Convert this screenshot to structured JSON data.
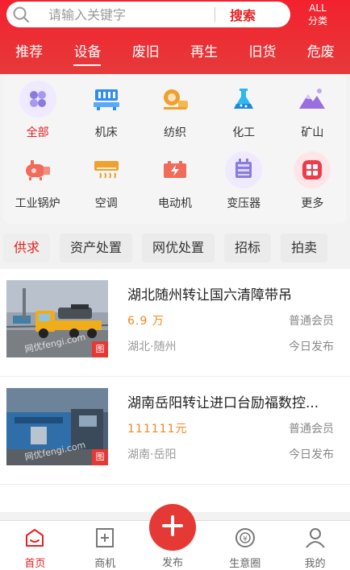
{
  "search": {
    "placeholder": "请输入关键字",
    "button_label": "搜索"
  },
  "all_categories": {
    "line1": "ALL",
    "line2": "分类"
  },
  "tabs": [
    {
      "label": "推荐"
    },
    {
      "label": "设备"
    },
    {
      "label": "废旧"
    },
    {
      "label": "再生"
    },
    {
      "label": "旧货"
    },
    {
      "label": "危废"
    }
  ],
  "active_tab": "设备",
  "categories": [
    {
      "label": "全部",
      "icon": "flower-icon",
      "color": "#8a7be0"
    },
    {
      "label": "机床",
      "icon": "machine-tool-icon",
      "color": "#2d8cf0"
    },
    {
      "label": "纺织",
      "icon": "textile-icon",
      "color": "#f0a02d"
    },
    {
      "label": "化工",
      "icon": "flask-icon",
      "color": "#2db7f5"
    },
    {
      "label": "矿山",
      "icon": "mountain-icon",
      "color": "#9b6de0"
    },
    {
      "label": "工业锅炉",
      "icon": "boiler-icon",
      "color": "#f06b5a"
    },
    {
      "label": "空调",
      "icon": "air-conditioner-icon",
      "color": "#f0a02d"
    },
    {
      "label": "电动机",
      "icon": "battery-icon",
      "color": "#f06b5a"
    },
    {
      "label": "变压器",
      "icon": "transformer-icon",
      "color": "#8a7be0"
    },
    {
      "label": "更多",
      "icon": "more-grid-icon",
      "color": "#ee3a4a"
    }
  ],
  "filters": [
    {
      "label": "供求"
    },
    {
      "label": "资产处置"
    },
    {
      "label": "网优处置"
    },
    {
      "label": "招标"
    },
    {
      "label": "拍卖"
    }
  ],
  "listings": [
    {
      "title": "湖北随州转让国六清障带吊",
      "price": "6.9 万",
      "member": "普通会员",
      "location": "湖北·随州",
      "time": "今日发布",
      "tag": "图",
      "watermark": "网优fengi.com"
    },
    {
      "title": "湖南岳阳转让进口台励福数控...",
      "price": "111111元",
      "member": "普通会员",
      "location": "湖南·岳阳",
      "time": "今日发布",
      "tag": "图",
      "watermark": "网优fengi.com"
    }
  ],
  "bottom_nav": [
    {
      "label": "首页",
      "icon": "home-icon"
    },
    {
      "label": "商机",
      "icon": "business-icon"
    },
    {
      "label": "发布",
      "icon": "plus-icon"
    },
    {
      "label": "生意圈",
      "icon": "yuan-circle-icon"
    },
    {
      "label": "我的",
      "icon": "user-icon"
    }
  ],
  "colors": {
    "brand_red": "#e52222",
    "price_orange": "#f08a1d"
  }
}
